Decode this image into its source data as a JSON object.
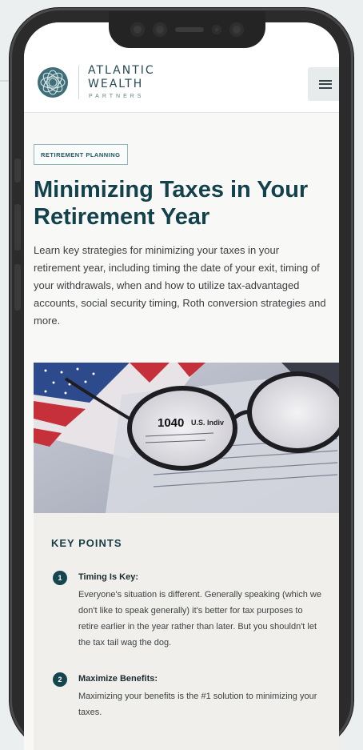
{
  "brand": {
    "line1": "ATLANTIC",
    "line2": "WEALTH",
    "line3": "PARTNERS"
  },
  "menu": {
    "icon": "hamburger-icon"
  },
  "article": {
    "category": "RETIREMENT PLANNING",
    "title": "Minimizing Taxes in Your Retirement Year",
    "intro": "Learn key strategies for minimizing your taxes in your retirement year, including timing the date of your exit, timing of your withdrawals, when and how to utilize tax-advantaged accounts, social security timing, Roth conversion strategies and more."
  },
  "hero": {
    "form_number": "1040",
    "form_label": "U.S. Indiv"
  },
  "key_points": {
    "heading": "KEY POINTS",
    "items": [
      {
        "number": "1",
        "title": "Timing Is Key:",
        "body": "Everyone's situation is different. Generally speaking (which we don't like to speak generally) it's better for tax purposes to retire earlier in the year rather than later. But you shouldn't let the tax tail wag the dog."
      },
      {
        "number": "2",
        "title": "Maximize Benefits:",
        "body": "Maximizing your benefits is the #1 solution to minimizing your taxes."
      }
    ]
  },
  "colors": {
    "accent": "#13424c",
    "badge_border": "#8fb8be",
    "phone_frame": "#2b2b2b"
  }
}
